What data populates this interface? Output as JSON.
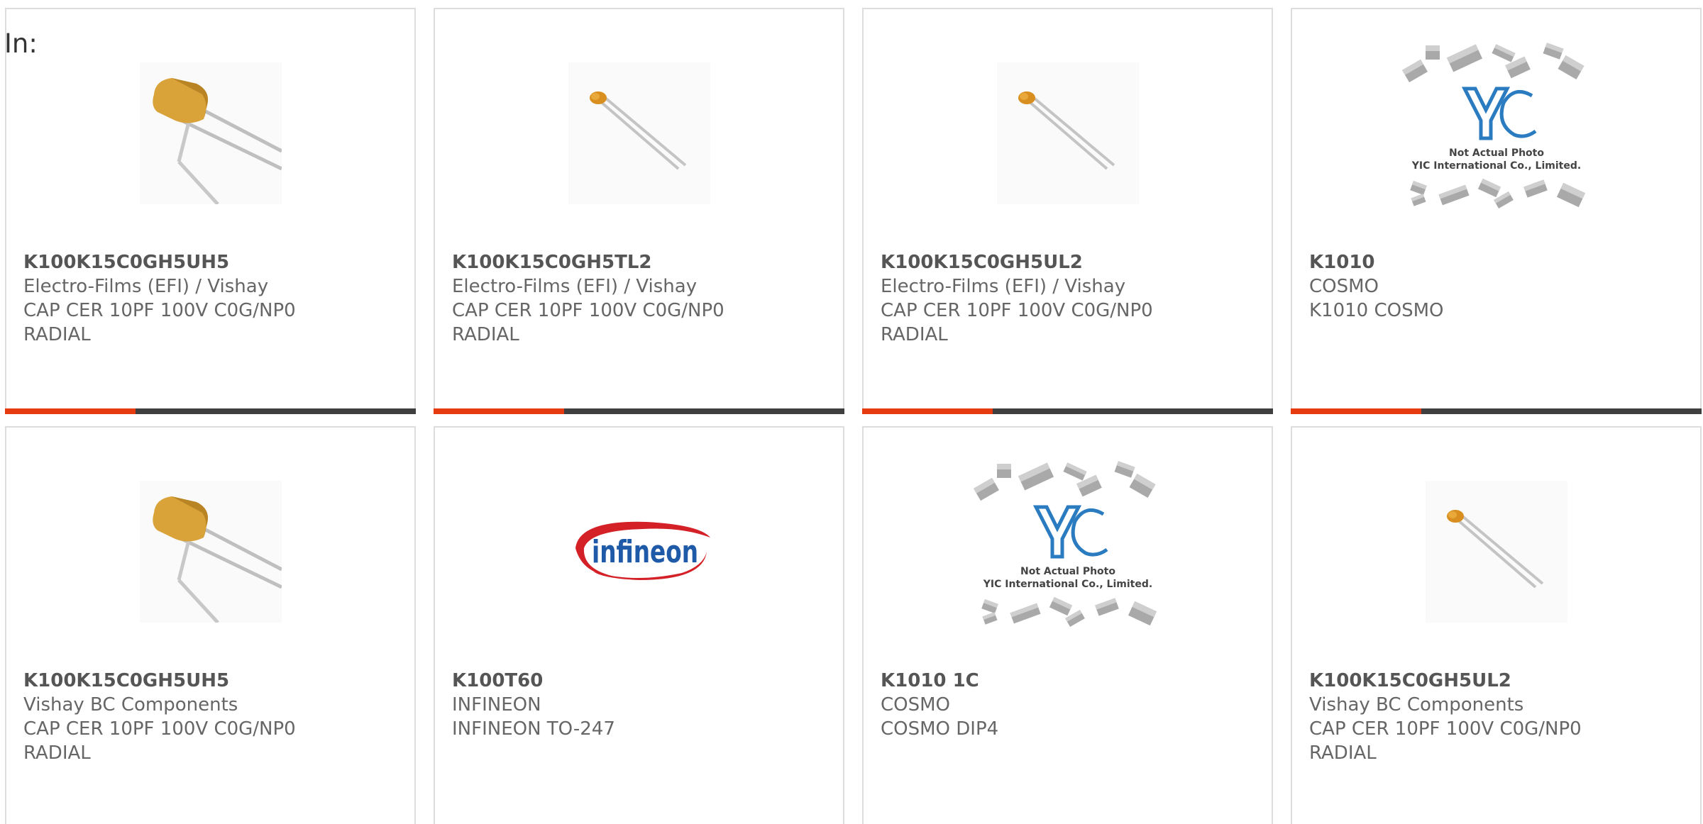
{
  "filter": {
    "label": "In:"
  },
  "theme": {
    "accent": "#e63b11",
    "bar": "#3f3f3f"
  },
  "products": [
    {
      "part_number": "K100K15C0GH5UH5",
      "manufacturer": "Electro-Films (EFI) / Vishay",
      "description_1": "CAP CER 10PF 100V C0G/NP0",
      "description_2": "RADIAL",
      "image": "ceramic-capacitor-large-icon"
    },
    {
      "part_number": "K100K15C0GH5TL2",
      "manufacturer": "Electro-Films (EFI) / Vishay",
      "description_1": "CAP CER 10PF 100V C0G/NP0",
      "description_2": "RADIAL",
      "image": "ceramic-capacitor-small-icon"
    },
    {
      "part_number": "K100K15C0GH5UL2",
      "manufacturer": "Electro-Films (EFI) / Vishay",
      "description_1": "CAP CER 10PF 100V C0G/NP0",
      "description_2": "RADIAL",
      "image": "ceramic-capacitor-small-icon"
    },
    {
      "part_number": "K1010",
      "manufacturer": "COSMO",
      "description_1": "K1010 COSMO",
      "description_2": "",
      "image": "yic-placeholder-icon",
      "placeholder_line1": "Not Actual Photo",
      "placeholder_line2": "YIC International Co., Limited."
    },
    {
      "part_number": "K100K15C0GH5UH5",
      "manufacturer": "Vishay BC Components",
      "description_1": "CAP CER 10PF 100V C0G/NP0",
      "description_2": "RADIAL",
      "image": "ceramic-capacitor-large-icon"
    },
    {
      "part_number": "K100T60",
      "manufacturer": "INFINEON",
      "description_1": "INFINEON TO-247",
      "description_2": "",
      "image": "infineon-logo-icon",
      "logo_text": "infineon"
    },
    {
      "part_number": "K1010 1C",
      "manufacturer": "COSMO",
      "description_1": "COSMO DIP4",
      "description_2": "",
      "image": "yic-placeholder-icon",
      "placeholder_line1": "Not Actual Photo",
      "placeholder_line2": "YIC International Co., Limited."
    },
    {
      "part_number": "K100K15C0GH5UL2",
      "manufacturer": "Vishay BC Components",
      "description_1": "CAP CER 10PF 100V C0G/NP0",
      "description_2": "RADIAL",
      "image": "ceramic-capacitor-small-icon"
    }
  ]
}
